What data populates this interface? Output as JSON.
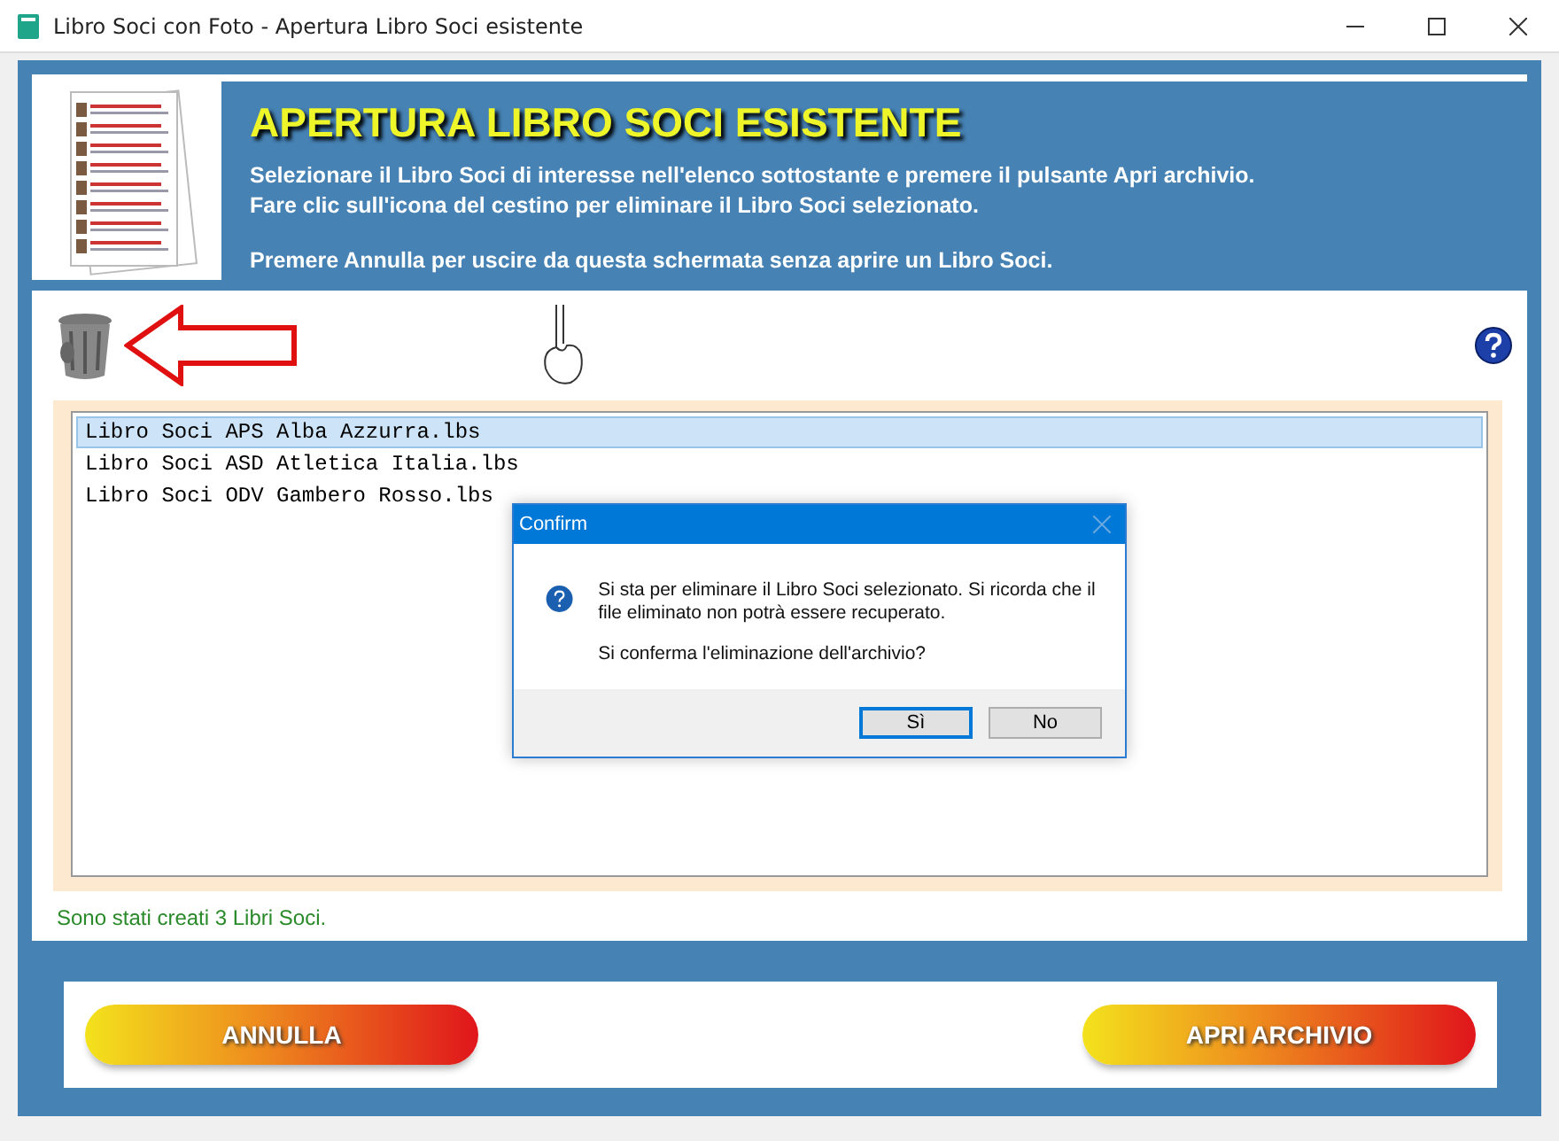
{
  "window": {
    "title": "Libro Soci con Foto - Apertura Libro Soci esistente"
  },
  "header": {
    "title": "APERTURA LIBRO SOCI ESISTENTE",
    "lines": [
      "Selezionare il Libro Soci di interesse nell'elenco sottostante e premere il pulsante Apri archivio.",
      "Fare clic sull'icona del cestino per eliminare il Libro Soci selezionato.",
      "Premere Annulla per uscire da questa schermata senza aprire un Libro Soci."
    ]
  },
  "files": [
    {
      "name": "Libro Soci APS Alba Azzurra.lbs",
      "selected": true
    },
    {
      "name": "Libro Soci ASD Atletica Italia.lbs",
      "selected": false
    },
    {
      "name": "Libro Soci ODV Gambero Rosso.lbs",
      "selected": false
    }
  ],
  "status": "Sono stati creati 3 Libri Soci.",
  "buttons": [
    "ANNULLA",
    "APRI ARCHIVIO"
  ],
  "dialog": {
    "title": "Confirm",
    "message": "Si sta per eliminare il Libro Soci selezionato. Si ricorda che il file eliminato non potrà essere recuperato.",
    "question": "Si conferma l'eliminazione dell'archivio?",
    "buttons": [
      {
        "label": "Sì",
        "selected": true
      },
      {
        "label": "No",
        "selected": false
      }
    ]
  }
}
